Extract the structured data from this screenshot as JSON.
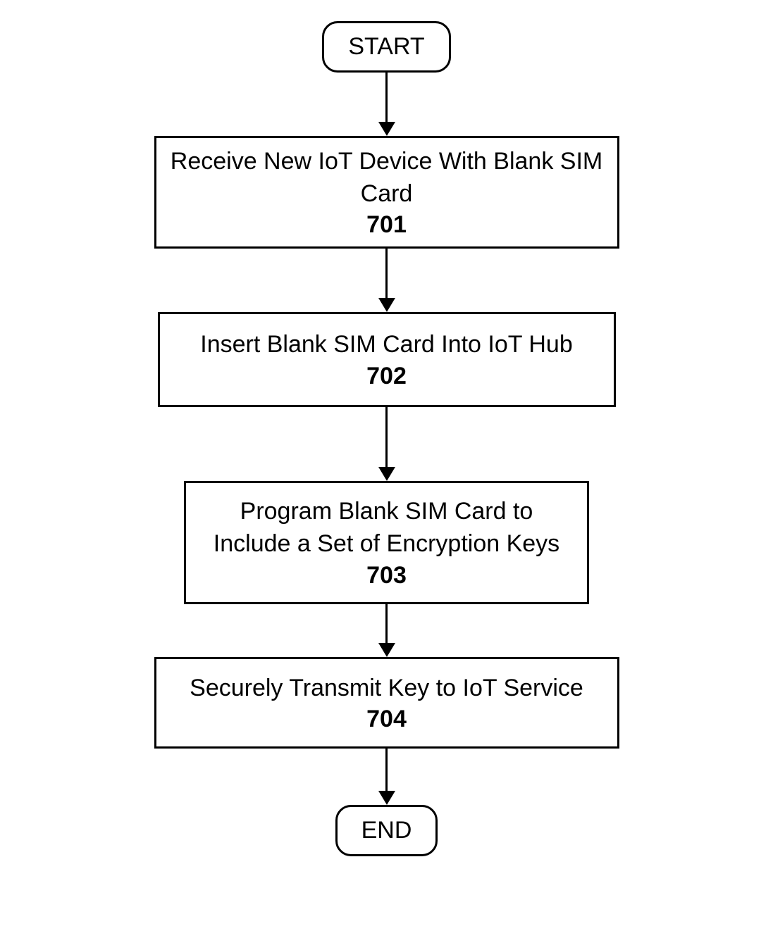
{
  "flowchart": {
    "start": "START",
    "end": "END",
    "steps": [
      {
        "text": "Receive New IoT Device With Blank SIM Card",
        "num": "701"
      },
      {
        "text": "Insert Blank SIM Card Into IoT Hub",
        "num": "702"
      },
      {
        "text": "Program Blank SIM Card to Include a Set of Encryption Keys",
        "num": "703"
      },
      {
        "text": "Securely Transmit Key to IoT Service",
        "num": "704"
      }
    ]
  }
}
